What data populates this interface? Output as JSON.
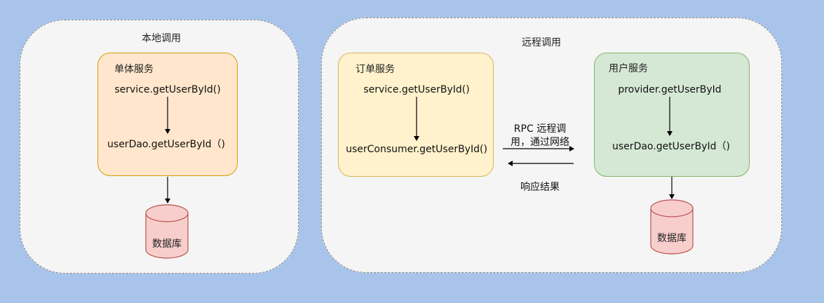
{
  "background_color": "#a9c4ea",
  "local_panel": {
    "title": "本地调用",
    "service_box": {
      "title": "单体服务",
      "top_call": "service.getUserById()",
      "bottom_call": "userDao.getUserById（)",
      "fill": "#ffe6cc",
      "stroke": "#d79b00"
    },
    "database": {
      "label": "数据库",
      "fill": "#f8cecc",
      "stroke": "#b85450"
    }
  },
  "remote_panel": {
    "title": "远程调用",
    "order_box": {
      "title": "订单服务",
      "top_call": "service.getUserById()",
      "bottom_call": "userConsumer.getUserById()",
      "fill": "#fff2cc",
      "stroke": "#d6b656"
    },
    "user_box": {
      "title": "用户服务",
      "top_call": "provider.getUserById",
      "bottom_call": "userDao.getUserById（)",
      "fill": "#d5e8d4",
      "stroke": "#82b366"
    },
    "rpc_label_line1": "RPC 远程调",
    "rpc_label_line2": "用，通过网络",
    "response_label": "响应结果",
    "database": {
      "label": "数据库",
      "fill": "#f8cecc",
      "stroke": "#b85450"
    }
  }
}
